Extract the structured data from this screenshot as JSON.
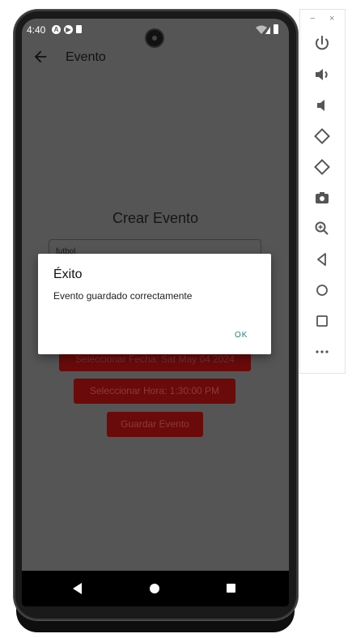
{
  "status_bar": {
    "time": "4:40"
  },
  "app_bar": {
    "title": "Evento"
  },
  "screen": {
    "heading": "Crear Evento",
    "name_field_value": "futbol",
    "date_button": "Seleccionar Fecha: Sat May 04 2024",
    "time_button": "Seleccionar Hora: 1:30:00 PM",
    "save_button": "Guardar Evento"
  },
  "dialog": {
    "title": "Éxito",
    "message": "Evento guardado correctamente",
    "ok_label": "OK"
  },
  "toolbar": {
    "minimize": "−",
    "close": "×",
    "buttons": [
      "power-icon",
      "volume-up-icon",
      "volume-down-icon",
      "rotate-left-icon",
      "rotate-right-icon",
      "camera-icon",
      "zoom-icon",
      "back-icon",
      "home-icon",
      "overview-icon",
      "more-icon"
    ]
  },
  "colors": {
    "screen_dim": "#555555",
    "button_red": "#6b0a0a",
    "dialog_bg": "#ffffff",
    "ok_teal": "#2e7d7d"
  }
}
